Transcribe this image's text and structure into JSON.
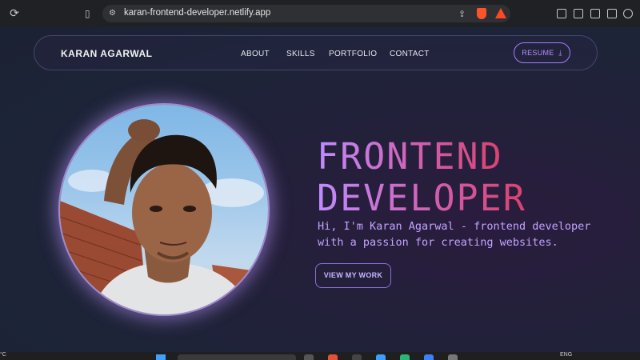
{
  "browser": {
    "url": "karan-frontend-developer.netlify.app",
    "icons": [
      "reload-icon",
      "bookmark-icon",
      "site-settings-icon",
      "share-icon",
      "brave-shields-icon",
      "brave-rewards-icon",
      "extensions-icon",
      "sidebar-icon",
      "wallet-icon",
      "leo-icon"
    ]
  },
  "nav": {
    "brand": "KARAN AGARWAL",
    "items": [
      "ABOUT",
      "SKILLS",
      "PORTFOLIO",
      "CONTACT"
    ],
    "resume_label": "RESUME"
  },
  "hero": {
    "line1": "FRONTEND",
    "line2": "DEVELOPER",
    "intro": "Hi, I'm Karan Agarwal - frontend developer with a passion for creating websites.",
    "cta_label": "VIEW MY WORK"
  },
  "colors": {
    "accent": "#a67cff",
    "gradient_start": "#c08cff",
    "gradient_end": "#d9426e"
  },
  "taskbar": {
    "temp": "°C",
    "lang": "ENG"
  }
}
